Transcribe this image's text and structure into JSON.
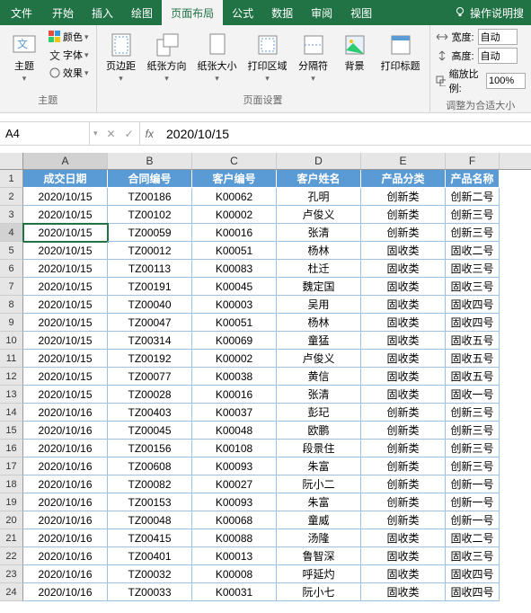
{
  "tabs": {
    "file": "文件",
    "items": [
      "开始",
      "插入",
      "绘图",
      "页面布局",
      "公式",
      "数据",
      "审阅",
      "视图"
    ],
    "help_placeholder": "操作说明搜"
  },
  "ribbon": {
    "themes": {
      "main": "主题",
      "colors": "颜色",
      "fonts": "字体",
      "effects": "效果",
      "group": "主题"
    },
    "page_setup": {
      "margins": "页边距",
      "orientation": "纸张方向",
      "size": "纸张大小",
      "print_area": "打印区域",
      "breaks": "分隔符",
      "background": "背景",
      "print_titles": "打印标题",
      "group": "页面设置"
    },
    "scale": {
      "width": "宽度:",
      "height": "高度:",
      "scale": "缩放比例:",
      "auto": "自动",
      "pct": "100%",
      "group": "调整为合适大小"
    }
  },
  "namebox": "A4",
  "formula": "2020/10/15",
  "cols": [
    "A",
    "B",
    "C",
    "D",
    "E",
    "F"
  ],
  "headers": [
    "成交日期",
    "合同编号",
    "客户编号",
    "客户姓名",
    "产品分类",
    "产品名称"
  ],
  "rows": [
    [
      "2020/10/15",
      "TZ00186",
      "K00062",
      "孔明",
      "创新类",
      "创新二号"
    ],
    [
      "2020/10/15",
      "TZ00102",
      "K00002",
      "卢俊义",
      "创新类",
      "创新三号"
    ],
    [
      "2020/10/15",
      "TZ00059",
      "K00016",
      "张清",
      "创新类",
      "创新三号"
    ],
    [
      "2020/10/15",
      "TZ00012",
      "K00051",
      "杨林",
      "固收类",
      "固收二号"
    ],
    [
      "2020/10/15",
      "TZ00113",
      "K00083",
      "杜迁",
      "固收类",
      "固收三号"
    ],
    [
      "2020/10/15",
      "TZ00191",
      "K00045",
      "魏定国",
      "固收类",
      "固收三号"
    ],
    [
      "2020/10/15",
      "TZ00040",
      "K00003",
      "吴用",
      "固收类",
      "固收四号"
    ],
    [
      "2020/10/15",
      "TZ00047",
      "K00051",
      "杨林",
      "固收类",
      "固收四号"
    ],
    [
      "2020/10/15",
      "TZ00314",
      "K00069",
      "童猛",
      "固收类",
      "固收五号"
    ],
    [
      "2020/10/15",
      "TZ00192",
      "K00002",
      "卢俊义",
      "固收类",
      "固收五号"
    ],
    [
      "2020/10/15",
      "TZ00077",
      "K00038",
      "黄信",
      "固收类",
      "固收五号"
    ],
    [
      "2020/10/15",
      "TZ00028",
      "K00016",
      "张清",
      "固收类",
      "固收一号"
    ],
    [
      "2020/10/16",
      "TZ00403",
      "K00037",
      "彭玘",
      "创新类",
      "创新三号"
    ],
    [
      "2020/10/16",
      "TZ00045",
      "K00048",
      "欧鹏",
      "创新类",
      "创新三号"
    ],
    [
      "2020/10/16",
      "TZ00156",
      "K00108",
      "段景住",
      "创新类",
      "创新三号"
    ],
    [
      "2020/10/16",
      "TZ00608",
      "K00093",
      "朱富",
      "创新类",
      "创新三号"
    ],
    [
      "2020/10/16",
      "TZ00082",
      "K00027",
      "阮小二",
      "创新类",
      "创新一号"
    ],
    [
      "2020/10/16",
      "TZ00153",
      "K00093",
      "朱富",
      "创新类",
      "创新一号"
    ],
    [
      "2020/10/16",
      "TZ00048",
      "K00068",
      "童威",
      "创新类",
      "创新一号"
    ],
    [
      "2020/10/16",
      "TZ00415",
      "K00088",
      "汤隆",
      "固收类",
      "固收二号"
    ],
    [
      "2020/10/16",
      "TZ00401",
      "K00013",
      "鲁智深",
      "固收类",
      "固收三号"
    ],
    [
      "2020/10/16",
      "TZ00032",
      "K00008",
      "呼延灼",
      "固收类",
      "固收四号"
    ],
    [
      "2020/10/16",
      "TZ00033",
      "K00031",
      "阮小七",
      "固收类",
      "固收四号"
    ]
  ]
}
